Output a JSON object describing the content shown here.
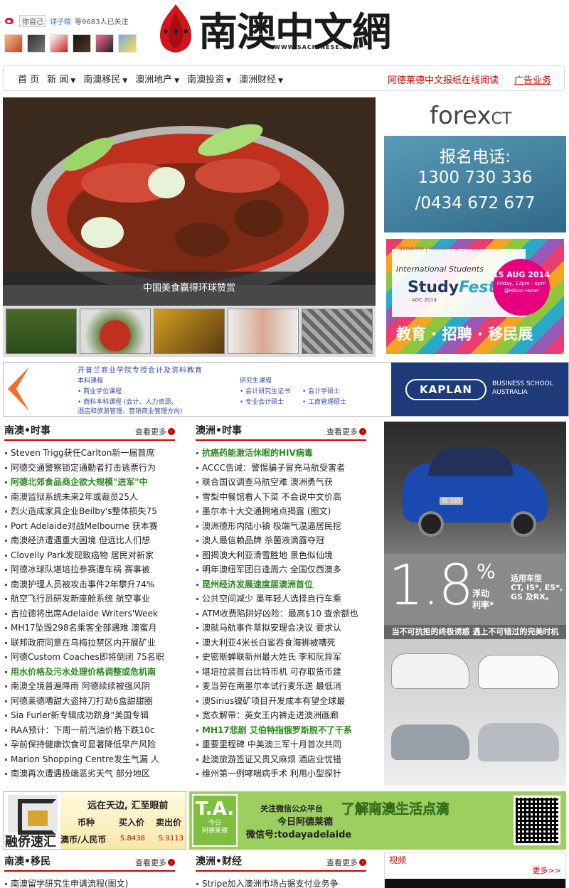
{
  "header": {
    "weibo_self": "你自己",
    "weibo_name": "详子晗",
    "weibo_fans": "等9683人已关注",
    "logo_title": "南澳中文網",
    "logo_url": "WWW.SACHINESE.COM"
  },
  "nav": {
    "items": [
      "首 页",
      "新 闻",
      "南澳移民",
      "澳洲地产",
      "南澳投资",
      "澳洲财经"
    ],
    "right_link_1": "阿德莱德中文报纸在线阅读",
    "right_link_2": "广告业务"
  },
  "hero": {
    "caption": "中国美食赢得环球赞赏"
  },
  "ads": {
    "forex": {
      "brand": "forex",
      "brand_suffix": "CT",
      "line1": "报名电话:",
      "line2": "1300 730 336",
      "line3": "/0434 672 677"
    },
    "study": {
      "locations": "BRISBANE | MELBOURNE | SYDNEY",
      "headline": "International Students",
      "brand": "Study",
      "brand2": "Fest",
      "sub": "ADC 2014",
      "date": "15 AUG 2014",
      "time": "Friday, 12pm - 6pm",
      "venue": "@Hilton Hotel",
      "cn": "教育 · 招聘 · 移民展"
    },
    "kaplan": {
      "title": "开普兰商业学院专授会计及资料教育",
      "l1": "本科课程",
      "l2": "• 商业学位课程",
      "l3": "• 商科本科课程 (会计、人力资源、",
      "l4": "  酒店和旅游管理、营销商业管理方向)",
      "r1": "研究生课程",
      "r2": "• 会计研究生证书",
      "r3": "• 会计学硕士",
      "r4": "• 专业会计硕士",
      "r5": "• 工商管理硕士",
      "logo": "KAPLAN",
      "school1": "BUSINESS SCHOOL",
      "school2": "AUSTRALIA"
    },
    "lexus": {
      "plate": "IS 350",
      "rate": "1.8",
      "pct": "%",
      "float1": "浮动",
      "float2": "利率*",
      "models1": "适用车型",
      "models2": "CT, IS*, ES*,",
      "models3": "GS 及RX。",
      "slogan": "当不可抗拒的终极诱惑  遇上不可错过的完美时机"
    },
    "huiqiao": {
      "name": "融侨速汇",
      "slogan": "远在天边, 汇至眼前",
      "h1": "币种",
      "h2": "买入价",
      "h3": "卖出价",
      "currency": "澳币/人民币",
      "buy": "5.8438",
      "sell": "5.9113"
    },
    "today": {
      "logo_big": "T.A.",
      "logo_sm1": "今日",
      "logo_sm2": "阿德莱德",
      "t1": "关注微信公众平台",
      "t2": "了解南澳生活点滴",
      "t3": "今日阿德莱德",
      "t4": "微信号:todayadelaide"
    }
  },
  "sections": {
    "more_label": "查看更多",
    "nanao": {
      "title": "南澳•时事",
      "items": [
        "Steven Trigg获任Carlton新一届首席",
        "阿德交通警察锁定通勤者打击逃票行为",
        "阿德北郊食品商企欲大规模\"进军\"中",
        "南澳监狱系统未来2年或裁员25人",
        "烈火造成家具企业Beilby's整体损失75",
        "Port Adelaide对战Melbourne 获本赛",
        "南澳经济遭遇重大困境 但远比人们想",
        "Clovelly Park发现致癌物 居民对新家",
        "阿德冰球队堪培拉参赛遭车祸 赛事被",
        "南澳护理人员被攻击事件2年攀升74%",
        "航空飞行员研发新座舱系统 航空事业",
        "吉拉德将出席Adelaide Writers'Week",
        "MH17坠毁298名乘客全部遇难 澳蜜月",
        "联邦政府同意在乌梅拉禁区内开展矿业",
        "阿德Custom Coaches即将倒闭 75名职",
        "用水价格及污水处理价格调整或危机南",
        "南澳全境普遍降雨 阿德续续被强风阴",
        "阿德莱德嘈甜大盗持刀打劫6盒甜甜圈",
        "Sia Furler新专辑成功跻身\"美国专辑",
        "RAA预计：下周一前汽油价格下跌10c",
        "孕前保持健康饮食可显著降低早产风险",
        "Marion Shopping Centre发生气漏 人",
        "南澳再次遭遇极端恶劣天气 部分地区"
      ],
      "highlights": [
        2,
        15
      ]
    },
    "aozhou": {
      "title": "澳洲•时事",
      "items": [
        "抗癌药能激活休眠的HIV病毒",
        "ACCC告诫：警惕骗子冒充马航受害者",
        "联合国议调查马航空难 澳洲勇气获",
        "雪梨中餐馆看人下菜 不会说中文价高",
        "墨尔本十大交通拥堵点揭露 (图文)",
        "澳洲德形内陆小镇 极端气温逼居民挖",
        "澳人最信赖品牌 杀菌液滴露夺冠",
        "图揭澳大利亚滑雪胜地 景色似仙境",
        "明年澳纽军团日逢周六 全国仅西澳多",
        "昆州经济发展速度居澳洲首位",
        "公共空间减少 墨年轻人选择自行车乘",
        "ATM收费陷阱好凶险：最高$10 查余额也",
        "澳就马航事件草拟安理会决议 要求认",
        "澳大利亚4米长白鲨吞食海狮被嘈死",
        "史密斯蝉联新州最大姓氏 李和阮异军",
        "堪培拉装首台比特币机 可存取货币建",
        "麦当劳在南墨尔本试行麦乐送 最低消",
        "澳Sirius镍矿项目开发成本有望全球最",
        "宽衣解带：英女王内裤走进澳洲画廊",
        "MH17悲剧 艾伯特指俄罗斯脱不了干系",
        "重要里程碑 中美澳三军十月首次共同",
        "赴澳旅游签证又贵又麻烦 酒店业忧错",
        "维州第一例哮喘病手术 利用小型探针"
      ],
      "highlights": [
        0,
        9,
        19
      ]
    },
    "bottom_left": {
      "title": "南澳•移民",
      "first_item": "南澳留学研究生申请流程(图文)"
    },
    "bottom_mid": {
      "title": "澳洲•财经",
      "first_item": "Stripe加入澳洲市场占据支付业务争"
    },
    "video": {
      "title": "视频",
      "more": "更多>>"
    }
  }
}
